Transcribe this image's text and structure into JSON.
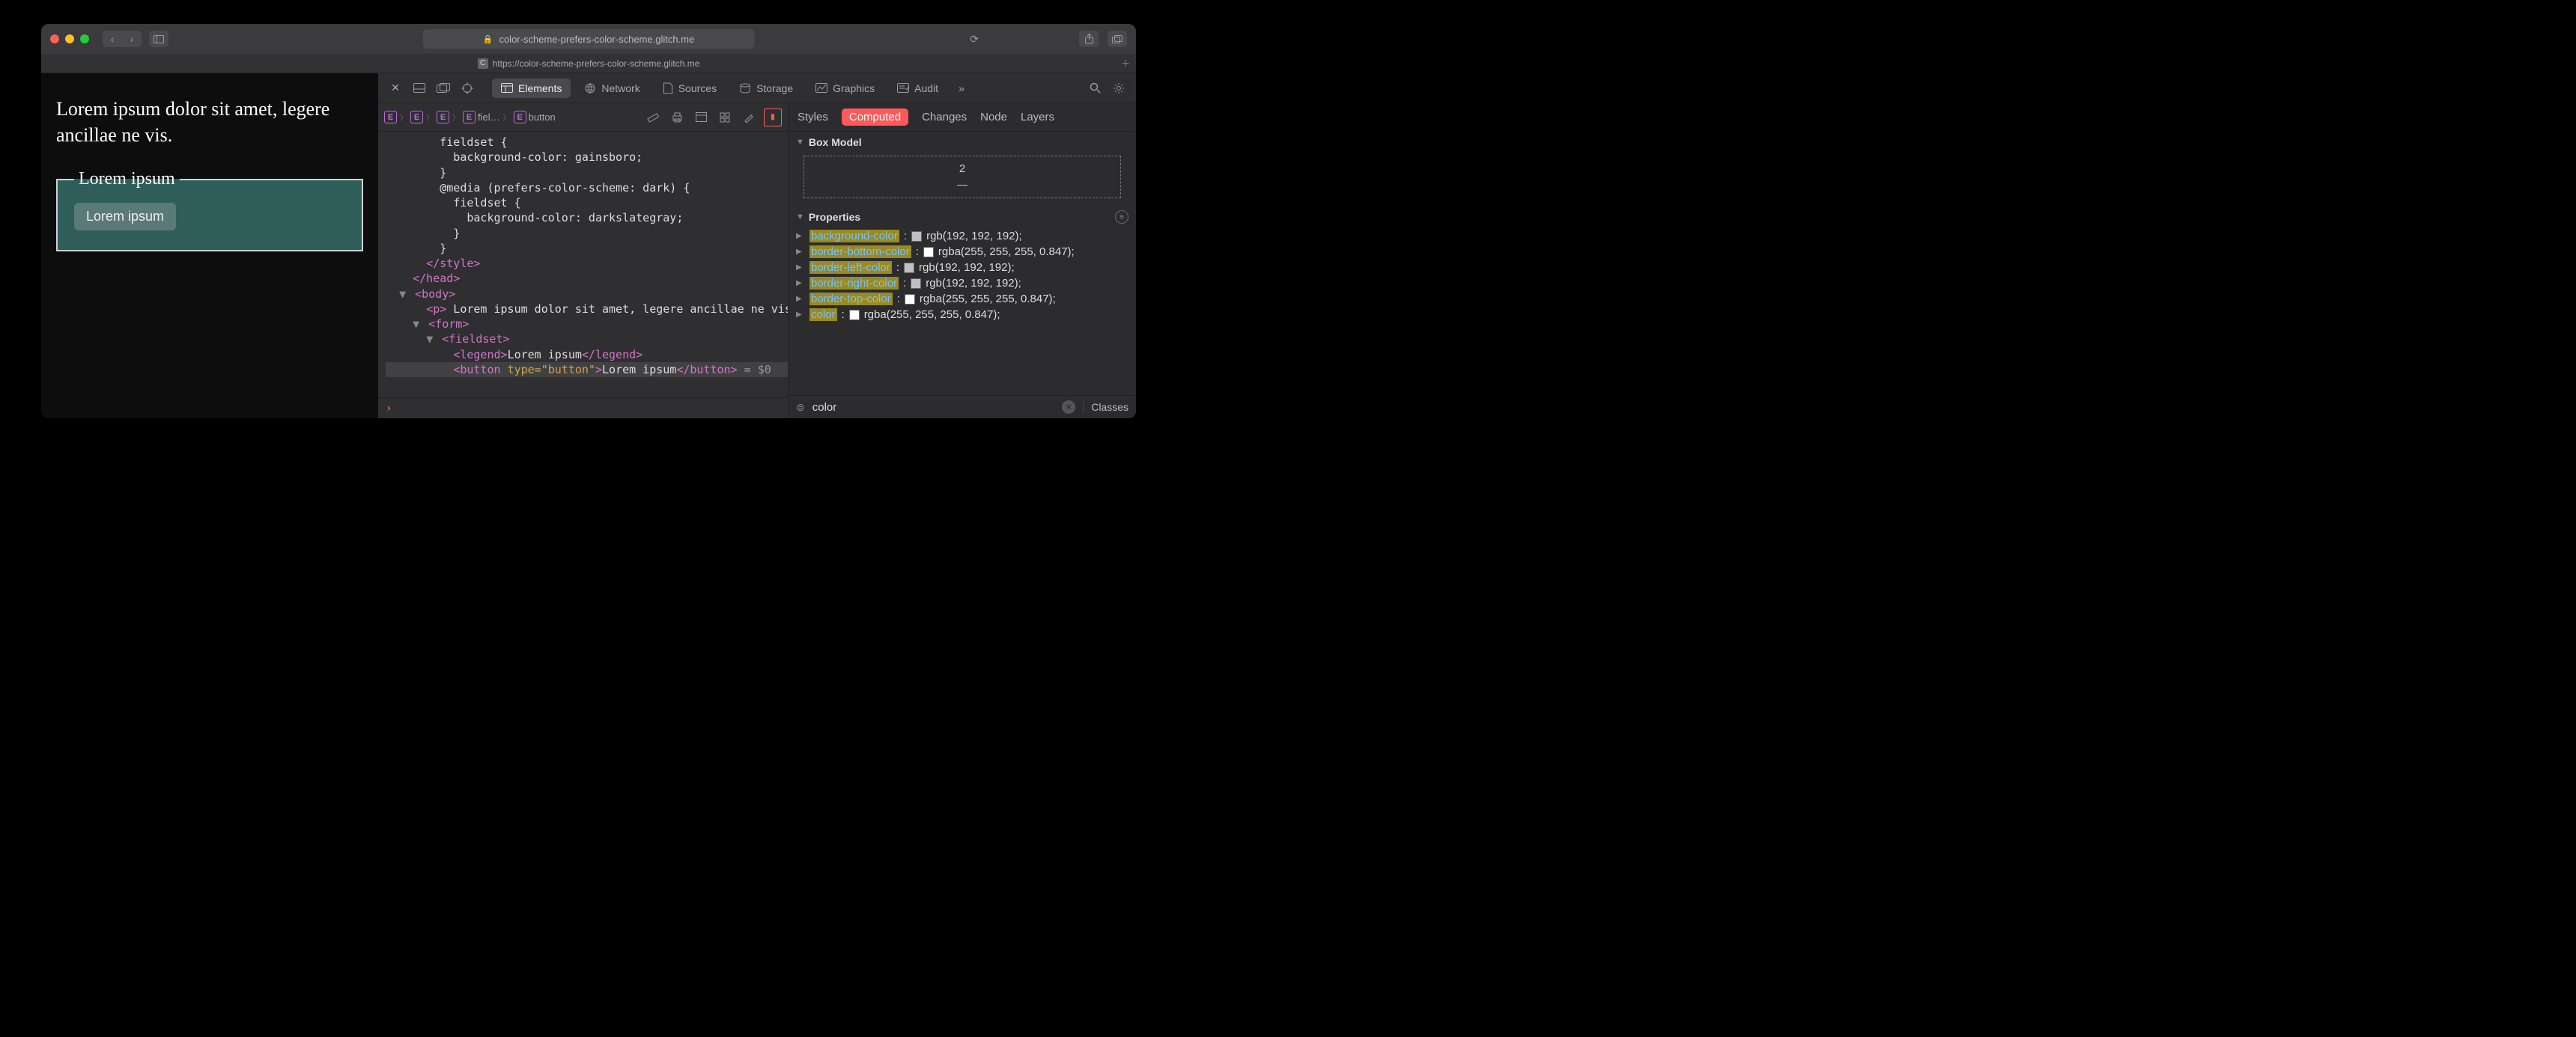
{
  "window": {
    "url_display": "color-scheme-prefers-color-scheme.glitch.me",
    "tab_title": "https://color-scheme-prefers-color-scheme.glitch.me"
  },
  "page": {
    "paragraph": "Lorem ipsum dolor sit amet, legere ancillae ne vis.",
    "legend": "Lorem ipsum",
    "button_label": "Lorem ipsum"
  },
  "devtools": {
    "tabs": [
      "Elements",
      "Network",
      "Sources",
      "Storage",
      "Graphics",
      "Audit"
    ],
    "active_tab": "Elements",
    "breadcrumbs": [
      "",
      "",
      "",
      "fiel…",
      "button"
    ],
    "dom_lines": [
      "        fieldset {",
      "          background-color: gainsboro;",
      "        }",
      "        @media (prefers-color-scheme: dark) {",
      "          fieldset {",
      "            background-color: darkslategray;",
      "          }",
      "        }",
      "      </style>",
      "    </head>",
      "  ▼ <body>",
      "      <p> Lorem ipsum dolor sit amet, legere ancillae ne vis. </p>",
      "    ▼ <form>",
      "      ▼ <fieldset>",
      "          <legend>Lorem ipsum</legend>",
      "          <button type=\"button\">Lorem ipsum</button> = $0"
    ]
  },
  "right_panel": {
    "tabs": [
      "Styles",
      "Computed",
      "Changes",
      "Node",
      "Layers"
    ],
    "active_tab": "Computed",
    "box_model_title": "Box Model",
    "box_model_value": "2",
    "box_model_dash": "—",
    "properties_title": "Properties",
    "properties": [
      {
        "name": "background-color",
        "value": "rgb(192, 192, 192)",
        "swatch": "#c0c0c0"
      },
      {
        "name": "border-bottom-color",
        "value": "rgba(255, 255, 255, 0.847)",
        "swatch": "#ffffff"
      },
      {
        "name": "border-left-color",
        "value": "rgb(192, 192, 192)",
        "swatch": "#c0c0c0"
      },
      {
        "name": "border-right-color",
        "value": "rgb(192, 192, 192)",
        "swatch": "#c0c0c0"
      },
      {
        "name": "border-top-color",
        "value": "rgba(255, 255, 255, 0.847)",
        "swatch": "#ffffff"
      },
      {
        "name": "color",
        "value": "rgba(255, 255, 255, 0.847)",
        "swatch": "#ffffff"
      }
    ],
    "filter_value": "color",
    "classes_label": "Classes"
  }
}
